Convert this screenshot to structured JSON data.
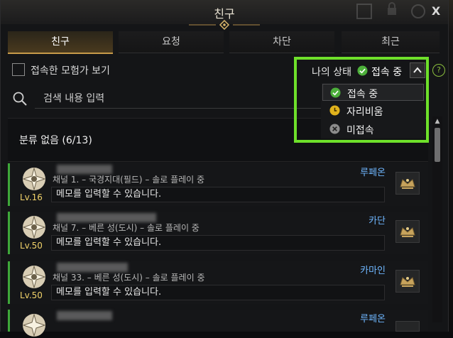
{
  "window": {
    "title": "친구",
    "close_label": "X"
  },
  "tabs": [
    {
      "label": "친구",
      "active": true
    },
    {
      "label": "요청",
      "active": false
    },
    {
      "label": "차단",
      "active": false
    },
    {
      "label": "최근",
      "active": false
    }
  ],
  "filter": {
    "show_online_label": "접속한 모험가 보기",
    "checked": false
  },
  "status": {
    "label": "나의 상태",
    "value": "접속 중",
    "help": "?"
  },
  "search": {
    "placeholder": "검색 내용 입력"
  },
  "group": {
    "title": "분류 없음 (6/13)"
  },
  "friends": [
    {
      "level": "Lv.16",
      "channel": "채널 1. – 국경지대(필드) – 솔로 플레이 중",
      "class": "루페온",
      "memo": "메모를 입력할 수 있습니다."
    },
    {
      "level": "Lv.50",
      "channel": "채널 7. – 베른 성(도시) – 솔로 플레이 중",
      "class": "카단",
      "memo": "메모를 입력할 수 있습니다."
    },
    {
      "level": "Lv.50",
      "channel": "채널 33. – 베른 성(도시) – 솔로 플레이 중",
      "class": "카마인",
      "memo": "메모를 입력할 수 있습니다."
    },
    {
      "level": "",
      "channel": "",
      "class": "루페온",
      "memo": ""
    }
  ],
  "status_menu": [
    {
      "label": "접속 중",
      "icon": "online-check-icon",
      "color": "#4caf3a",
      "selected": true
    },
    {
      "label": "자리비움",
      "icon": "away-clock-icon",
      "color": "#e0b21c",
      "selected": false
    },
    {
      "label": "미접속",
      "icon": "offline-x-icon",
      "color": "#8c8c8c",
      "selected": false
    }
  ],
  "colors": {
    "accent_gold": "#c79a4a",
    "online_green": "#3ea83a",
    "highlight_green": "#6ee02a",
    "class_blue": "#6fb7ff",
    "level_yellow": "#f2d36a"
  }
}
